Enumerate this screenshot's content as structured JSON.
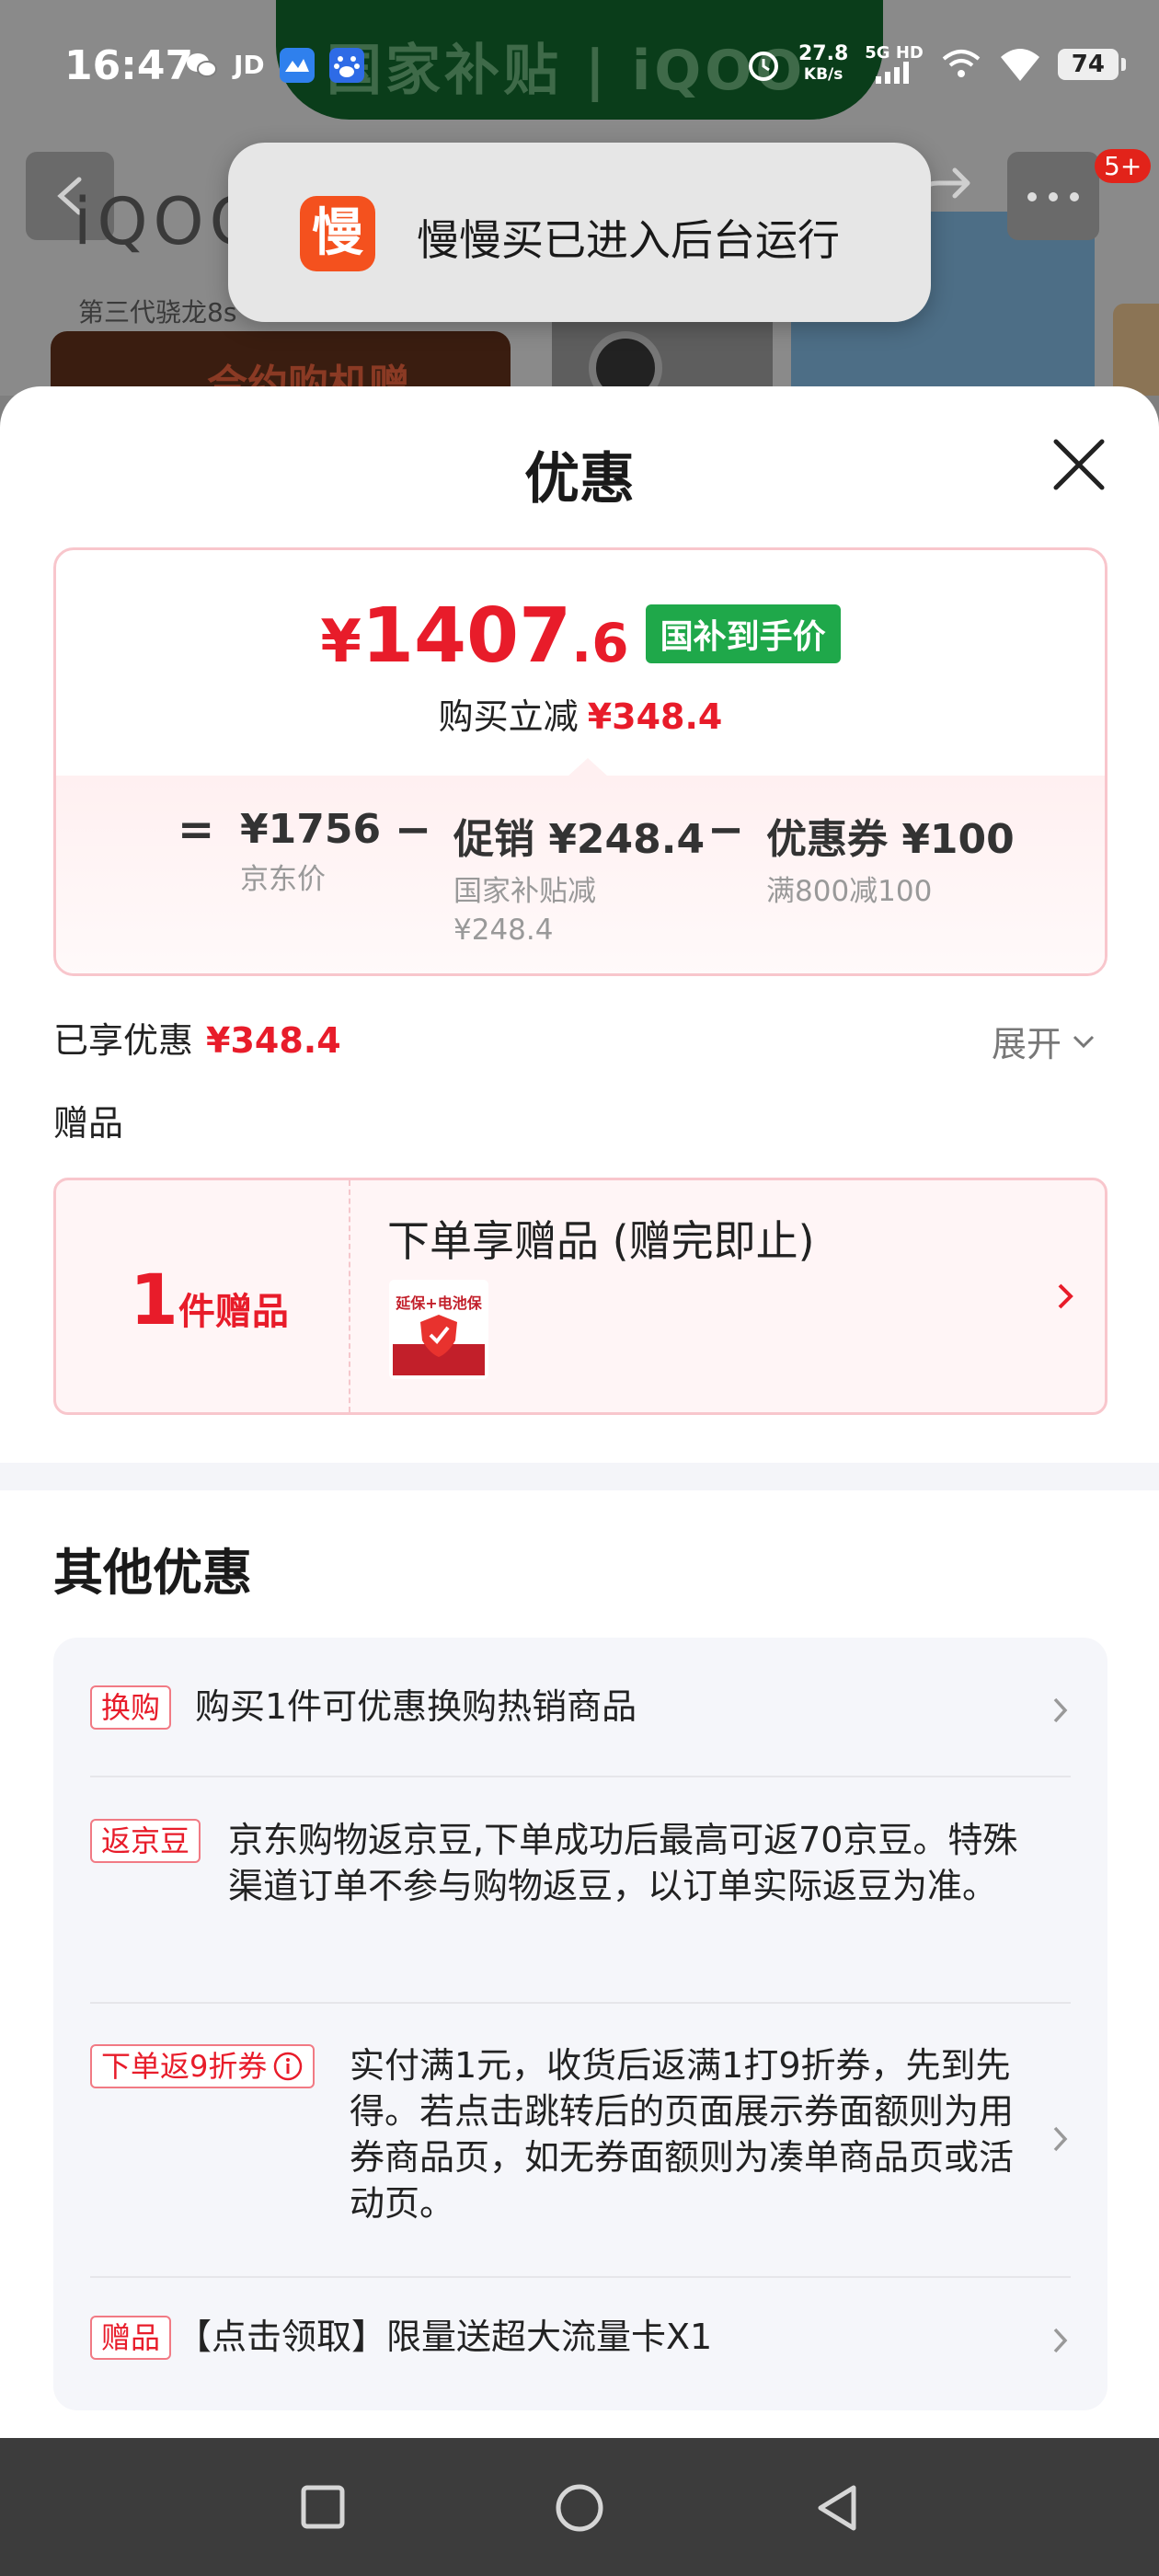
{
  "status_bar": {
    "time": "16:47",
    "app_icons": [
      "wechat-icon",
      "jd-icon",
      "mail-icon",
      "baidu-icon"
    ],
    "jd_label": "JD",
    "speed_value": "27.8",
    "speed_unit": "KB/s",
    "network": "5G HD",
    "battery": "74"
  },
  "background_page": {
    "banner_text": "国家补贴 | iQOO",
    "badge": "5+",
    "subtitle": "第三代骁龙8s",
    "red_card_text": "合约购机赠"
  },
  "toast": {
    "app_icon_char": "慢",
    "message": "慢慢买已进入后台运行"
  },
  "sheet": {
    "title": "优惠",
    "price": {
      "currency": "¥",
      "integer": "1407",
      "decimal": ".6",
      "tag": "国补到手价",
      "save_label": "购买立减",
      "save_value": "¥348.4"
    },
    "formula": {
      "eq": "=",
      "minus1": "−",
      "minus2": "−",
      "items": [
        {
          "value": "¥1756",
          "label": "京东价"
        },
        {
          "value": "促销 ¥248.4",
          "label": "国家补贴减",
          "label2": "¥248.4"
        },
        {
          "value": "优惠券 ¥100",
          "label": "满800减100"
        }
      ]
    },
    "enjoyed_label": "已享优惠",
    "enjoyed_value": "¥348.4",
    "expand_label": "展开",
    "gift_section_title": "赠品",
    "gift": {
      "count": "1",
      "count_unit": "件赠品",
      "headline": "下单享赠品 (赠完即止)",
      "thumb_text": "延保+电池保"
    },
    "other_title": "其他优惠",
    "other_rows": [
      {
        "tag": "换购",
        "text": "购买1件可优惠换购热销商品"
      },
      {
        "tag": "返京豆",
        "text": "京东购物返京豆,下单成功后最高可返70京豆。特殊渠道订单不参与购物返豆，以订单实际返豆为准。"
      },
      {
        "tag": "下单返9折券",
        "text": "实付满1元，收货后返满1打9折券，先到先得。若点击跳转后的页面展示券面额则为用券商品页，如无券面额则为凑单商品页或活动页。"
      },
      {
        "tag": "赠品",
        "text": "【点击领取】限量送超大流量卡X1"
      }
    ]
  },
  "colors": {
    "accent_red": "#e81c2a",
    "tag_green": "#1fa84a",
    "toast_icon": "#f4511e"
  }
}
